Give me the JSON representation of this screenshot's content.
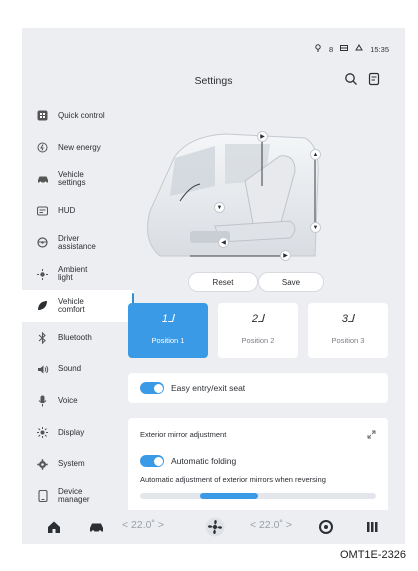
{
  "status": {
    "signal": "8",
    "time": "15:35"
  },
  "header": {
    "title": "Settings"
  },
  "sidebar": {
    "items": [
      {
        "label": "Quick control",
        "icon": "quick-control-icon"
      },
      {
        "label": "New energy",
        "icon": "new-energy-icon"
      },
      {
        "label": "Vehicle\nsettings",
        "icon": "car-icon"
      },
      {
        "label": "HUD",
        "icon": "hud-icon"
      },
      {
        "label": "Driver\nassistance",
        "icon": "steering-wheel-icon"
      },
      {
        "label": "Ambient\nlight",
        "icon": "ambient-light-icon"
      },
      {
        "label": "Vehicle\ncomfort",
        "icon": "comfort-leaf-icon",
        "active": true
      },
      {
        "label": "Bluetooth",
        "icon": "bluetooth-icon"
      },
      {
        "label": "Sound",
        "icon": "speaker-icon"
      },
      {
        "label": "Voice",
        "icon": "microphone-icon"
      },
      {
        "label": "Display",
        "icon": "sun-icon"
      },
      {
        "label": "System",
        "icon": "gear-icon"
      },
      {
        "label": "Device\nmanager",
        "icon": "device-icon"
      }
    ]
  },
  "seat": {
    "reset_label": "Reset",
    "save_label": "Save",
    "positions": [
      {
        "num": "1",
        "label": "Position 1",
        "selected": true
      },
      {
        "num": "2",
        "label": "Position 2"
      },
      {
        "num": "3",
        "label": "Position 3"
      }
    ]
  },
  "easy_entry": {
    "label": "Easy entry/exit seat",
    "on": true
  },
  "mirror": {
    "title": "Exterior mirror adjustment",
    "auto_folding_label": "Automatic folding",
    "auto_folding_on": true,
    "reverse_label": "Automatic adjustment of exterior mirrors when reversing"
  },
  "dock": {
    "left_temp": "< 22.0˚ >",
    "right_temp": "< 22.0˚ >"
  },
  "caption": "OMT1E-2326",
  "colors": {
    "accent": "#3a9ae6",
    "background": "#eceef1"
  }
}
